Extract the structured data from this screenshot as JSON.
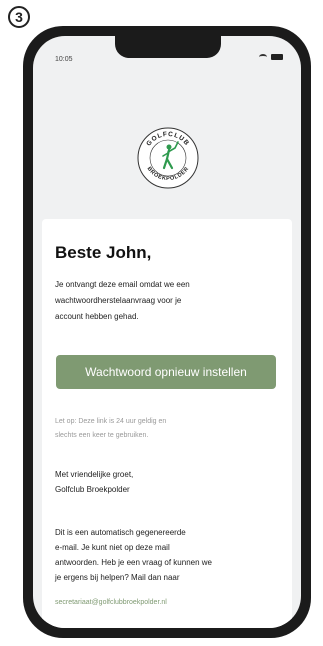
{
  "step": {
    "number": "3"
  },
  "status_bar": {
    "time": "10:05"
  },
  "logo": {
    "top_text": "GOLFCLUB",
    "bottom_text": "BROEKPOLDER"
  },
  "email": {
    "greeting": "Beste John,",
    "intro": [
      "Je ontvangt deze email omdat we een",
      "wachtwoordherstelaanvraag voor je",
      "account hebben gehad."
    ],
    "button_label": "Wachtwoord opnieuw instellen",
    "note": [
      "Let op: Deze link is 24 uur geldig en",
      "slechts een keer te gebruiken."
    ],
    "signoff": [
      "Met vriendelijke groet,",
      "Golfclub Broekpolder"
    ],
    "auto_text": [
      "Dit is een automatisch gegenereerde",
      "e-mail. Je kunt niet op deze mail",
      "antwoorden. Heb je een vraag of kunnen we",
      "je ergens bij helpen? Mail dan naar"
    ],
    "contact_email": "secretariaat@golfclubbroekpolder.nl"
  },
  "colors": {
    "accent": "#7f9a72",
    "phone_frame": "#1b1b1b",
    "logo_figure": "#2e9a4e"
  }
}
